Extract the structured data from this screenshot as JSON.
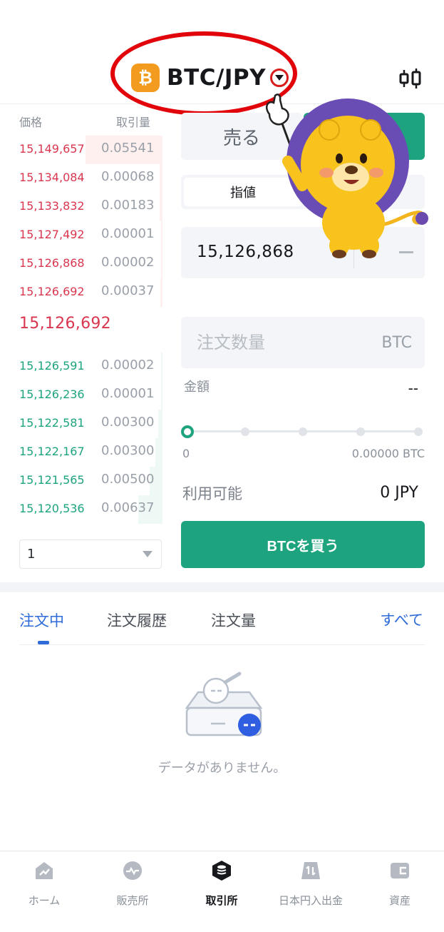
{
  "header": {
    "pair_title": "BTC/JPY",
    "logo_glyph": "₿",
    "chart_icon": "candlestick-chart-icon"
  },
  "order_book": {
    "price_header": "価格",
    "qty_header": "取引量",
    "asks": [
      {
        "price": "15,149,657",
        "qty": "0.05541"
      },
      {
        "price": "15,134,084",
        "qty": "0.00068"
      },
      {
        "price": "15,133,832",
        "qty": "0.00183"
      },
      {
        "price": "15,127,492",
        "qty": "0.00001"
      },
      {
        "price": "15,126,868",
        "qty": "0.00002"
      },
      {
        "price": "15,126,692",
        "qty": "0.00037"
      }
    ],
    "last_price": "15,126,692",
    "bids": [
      {
        "price": "15,126,591",
        "qty": "0.00002"
      },
      {
        "price": "15,126,236",
        "qty": "0.00001"
      },
      {
        "price": "15,122,581",
        "qty": "0.00300"
      },
      {
        "price": "15,122,167",
        "qty": "0.00300"
      },
      {
        "price": "15,121,565",
        "qty": "0.00500"
      },
      {
        "price": "15,120,536",
        "qty": "0.00637"
      }
    ],
    "depth_value": "1"
  },
  "order_form": {
    "sell_label": "売る",
    "order_type": "指値",
    "price": "15,126,868",
    "qty_placeholder": "注文数量",
    "qty_unit": "BTC",
    "amount_label": "金額",
    "amount_value": "--",
    "slider_min": "0",
    "slider_max": "0.00000 BTC",
    "available_label": "利用可能",
    "available_value": "0 JPY",
    "buy_button": "BTCを買う"
  },
  "orders": {
    "tabs": [
      "注文中",
      "注文履歴",
      "注文量"
    ],
    "all_link": "すべて",
    "empty_text": "データがありません。"
  },
  "bottom_nav": [
    {
      "label": "ホーム",
      "icon": "home-chart-icon"
    },
    {
      "label": "販売所",
      "icon": "exchange-wave-icon"
    },
    {
      "label": "取引所",
      "icon": "coin-stack-icon",
      "active": true
    },
    {
      "label": "日本円入出金",
      "icon": "deposit-withdraw-icon"
    },
    {
      "label": "資産",
      "icon": "wallet-icon"
    }
  ],
  "colors": {
    "ask": "#d9364f",
    "bid": "#1ea37f",
    "accent": "#2f6bd9",
    "buy_button": "#1ea37f",
    "btc_logo": "#f39b1f",
    "highlight_ellipse": "#e1040a"
  }
}
